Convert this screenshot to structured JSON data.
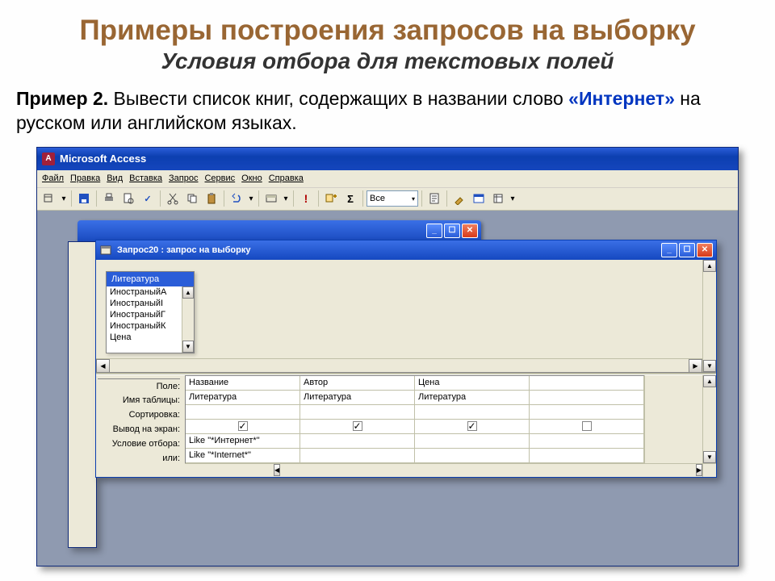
{
  "slide": {
    "title": "Примеры построения запросов на выборку",
    "subtitle": "Условия отбора для текстовых полей",
    "example_label": "Пример 2.",
    "body_part1": " Вывести список книг,  содержащих в названии слово ",
    "keyword": "«Интернет»",
    "body_part2": " на русском или английском языках."
  },
  "app": {
    "title": "Microsoft Access",
    "menu": [
      "Файл",
      "Правка",
      "Вид",
      "Вставка",
      "Запрос",
      "Сервис",
      "Окно",
      "Справка"
    ],
    "toolbar_combo": "Все"
  },
  "query_window": {
    "title": "Запрос20 : запрос на выборку",
    "table_name": "Литература",
    "fields": [
      "ИностраныйА",
      "ИностраныйI",
      "ИностраныйГ",
      "ИностраныйК",
      "Цена"
    ]
  },
  "qbe": {
    "labels": {
      "field": "Поле:",
      "table": "Имя таблицы:",
      "sort": "Сортировка:",
      "show": "Вывод на экран:",
      "criteria": "Условие отбора:",
      "or": "или:"
    },
    "columns": [
      {
        "field": "Название",
        "table": "Литература",
        "show": true,
        "criteria": "Like \"*Интернет*\"",
        "or": "Like \"*Internet*\""
      },
      {
        "field": "Автор",
        "table": "Литература",
        "show": true,
        "criteria": "",
        "or": ""
      },
      {
        "field": "Цена",
        "table": "Литература",
        "show": true,
        "criteria": "",
        "or": ""
      },
      {
        "field": "",
        "table": "",
        "show": false,
        "criteria": "",
        "or": ""
      }
    ]
  }
}
